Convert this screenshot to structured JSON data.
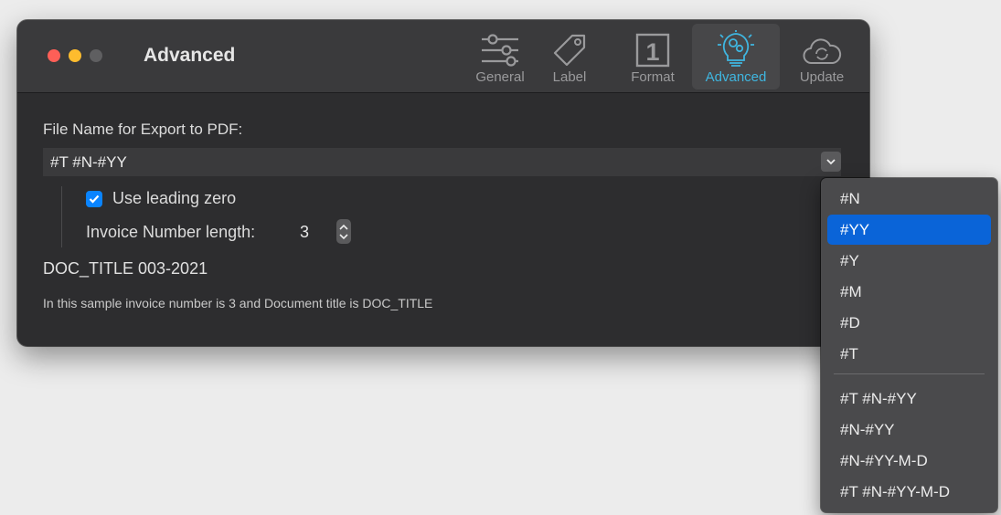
{
  "window": {
    "title": "Advanced"
  },
  "toolbar": {
    "items": [
      {
        "label": "General",
        "icon": "sliders-icon"
      },
      {
        "label": "Label",
        "icon": "tag-icon"
      },
      {
        "label": "Format",
        "icon": "number-one-icon",
        "icon_text": "1"
      },
      {
        "label": "Advanced",
        "icon": "gears-lightbulb-icon",
        "active": true
      },
      {
        "label": "Update",
        "icon": "cloud-sync-icon"
      }
    ]
  },
  "content": {
    "filename_label": "File Name for Export to PDF:",
    "filename_value": "#T #N-#YY",
    "leading_zero_label": "Use leading zero",
    "leading_zero_checked": true,
    "length_label": "Invoice Number length:",
    "length_value": "3",
    "sample": "DOC_TITLE 003-2021",
    "note": "In this sample invoice number is 3 and Document title is DOC_TITLE"
  },
  "dropdown": {
    "selected": "#YY",
    "group1": [
      "#N",
      "#YY",
      "#Y",
      "#M",
      "#D",
      "#T"
    ],
    "group2": [
      "#T #N-#YY",
      "#N-#YY",
      "#N-#YY-M-D",
      "#T #N-#YY-M-D"
    ]
  },
  "colors": {
    "accent": "#3fb6e0",
    "selection": "#0a64d8",
    "close": "#fe5f57",
    "minimize": "#febc2e",
    "checkbox": "#0a84ff"
  }
}
